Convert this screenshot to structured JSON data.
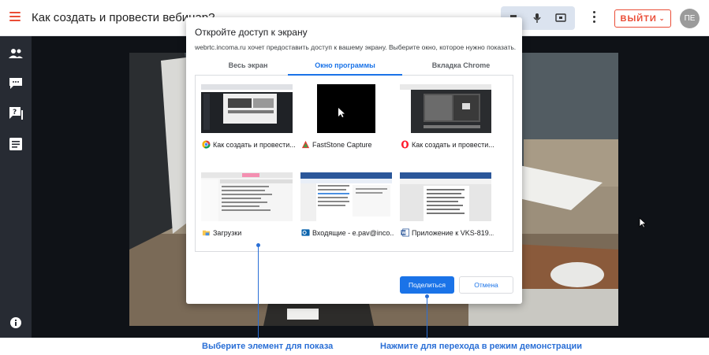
{
  "header": {
    "title": "Как создать и провести вебинар?",
    "exit_label": "ВЫЙТИ",
    "avatar_initials": "ПЕ"
  },
  "sidebar": {
    "icons": [
      "participants-icon",
      "chat-icon",
      "questions-icon",
      "notes-icon",
      "info-icon"
    ]
  },
  "dialog": {
    "title": "Откройте доступ к экрану",
    "subtitle": "webrtc.incoma.ru хочет предоставить доступ к вашему экрану. Выберите окно, которое нужно показать.",
    "tabs": [
      {
        "label": "Весь экран",
        "active": false
      },
      {
        "label": "Окно программы",
        "active": true
      },
      {
        "label": "Вкладка Chrome",
        "active": false
      }
    ],
    "windows": [
      {
        "label": "Как создать и провести...",
        "icon": "chrome-icon"
      },
      {
        "label": "FastStone Capture",
        "icon": "faststone-icon"
      },
      {
        "label": "Как создать и провести...",
        "icon": "opera-icon"
      },
      {
        "label": "Загрузки",
        "icon": "folder-icon"
      },
      {
        "label": "Входящие - e.pav@inco...",
        "icon": "outlook-icon"
      },
      {
        "label": "Приложение к VKS-819...",
        "icon": "word-icon"
      }
    ],
    "share_label": "Поделиться",
    "cancel_label": "Отмена"
  },
  "callouts": {
    "select_hint": "Выберите элемент для показа",
    "share_hint": "Нажмите для перехода в режим демонстрации"
  },
  "colors": {
    "accent": "#ea4c36",
    "chrome_blue": "#1a73e8",
    "callout_blue": "#2a6fd6",
    "sidebar": "#272b33"
  }
}
